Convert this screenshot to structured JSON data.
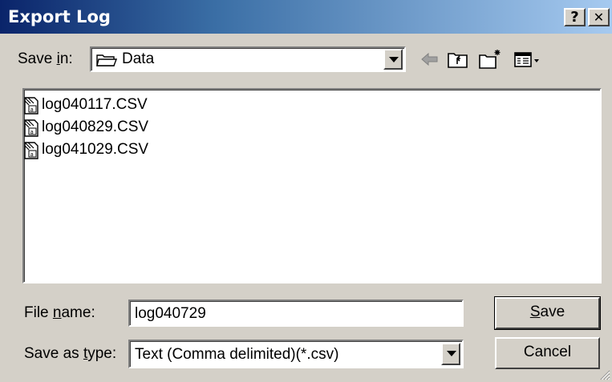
{
  "window": {
    "title": "Export Log",
    "help_glyph": "?",
    "close_glyph": "✕"
  },
  "save_in": {
    "label_pre": "Save ",
    "label_accel": "i",
    "label_post": "n:",
    "value": "Data",
    "icon": "folder-icon"
  },
  "toolbar": {
    "icons": [
      "back-arrow-icon",
      "up-one-level-icon",
      "create-new-folder-icon",
      "view-menu-icon"
    ]
  },
  "files": [
    {
      "name": "log040117.CSV",
      "icon": "csv-file-icon"
    },
    {
      "name": "log040829.CSV",
      "icon": "csv-file-icon"
    },
    {
      "name": "log041029.CSV",
      "icon": "csv-file-icon"
    }
  ],
  "file_name": {
    "label_pre": "File ",
    "label_accel": "n",
    "label_post": "ame:",
    "value": "log040729"
  },
  "save_as_type": {
    "label_pre": "Save as ",
    "label_accel": "t",
    "label_post": "ype:",
    "value": "Text (Comma delimited)(*.csv)"
  },
  "buttons": {
    "save_accel": "S",
    "save_rest": "ave",
    "cancel": "Cancel"
  }
}
